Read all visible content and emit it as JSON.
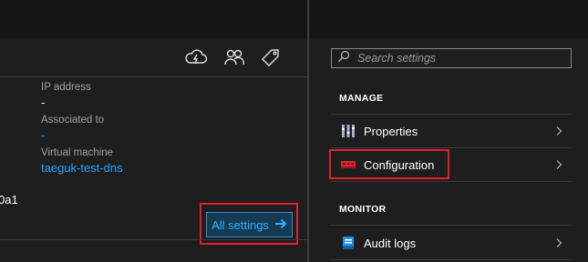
{
  "left": {
    "properties": [
      {
        "label": "IP address",
        "value": "-"
      },
      {
        "label": "Associated to",
        "value": "-"
      },
      {
        "label": "Virtual machine",
        "value": "taeguk-test-dns"
      }
    ],
    "partial_text": "0a1",
    "all_settings_label": "All settings"
  },
  "toolbar_icons": [
    "cloud-lightning-icon",
    "users-icon",
    "tag-icon"
  ],
  "right": {
    "search_placeholder": "Search settings",
    "sections": [
      {
        "title": "MANAGE",
        "items": [
          {
            "label": "Properties",
            "icon": "properties-icon"
          },
          {
            "label": "Configuration",
            "icon": "configuration-icon"
          }
        ]
      },
      {
        "title": "MONITOR",
        "items": [
          {
            "label": "Audit logs",
            "icon": "audit-logs-icon"
          }
        ]
      }
    ]
  },
  "colors": {
    "highlight": "#e41e2b",
    "link": "#1ea7ff",
    "background": "#1e1e1e"
  }
}
